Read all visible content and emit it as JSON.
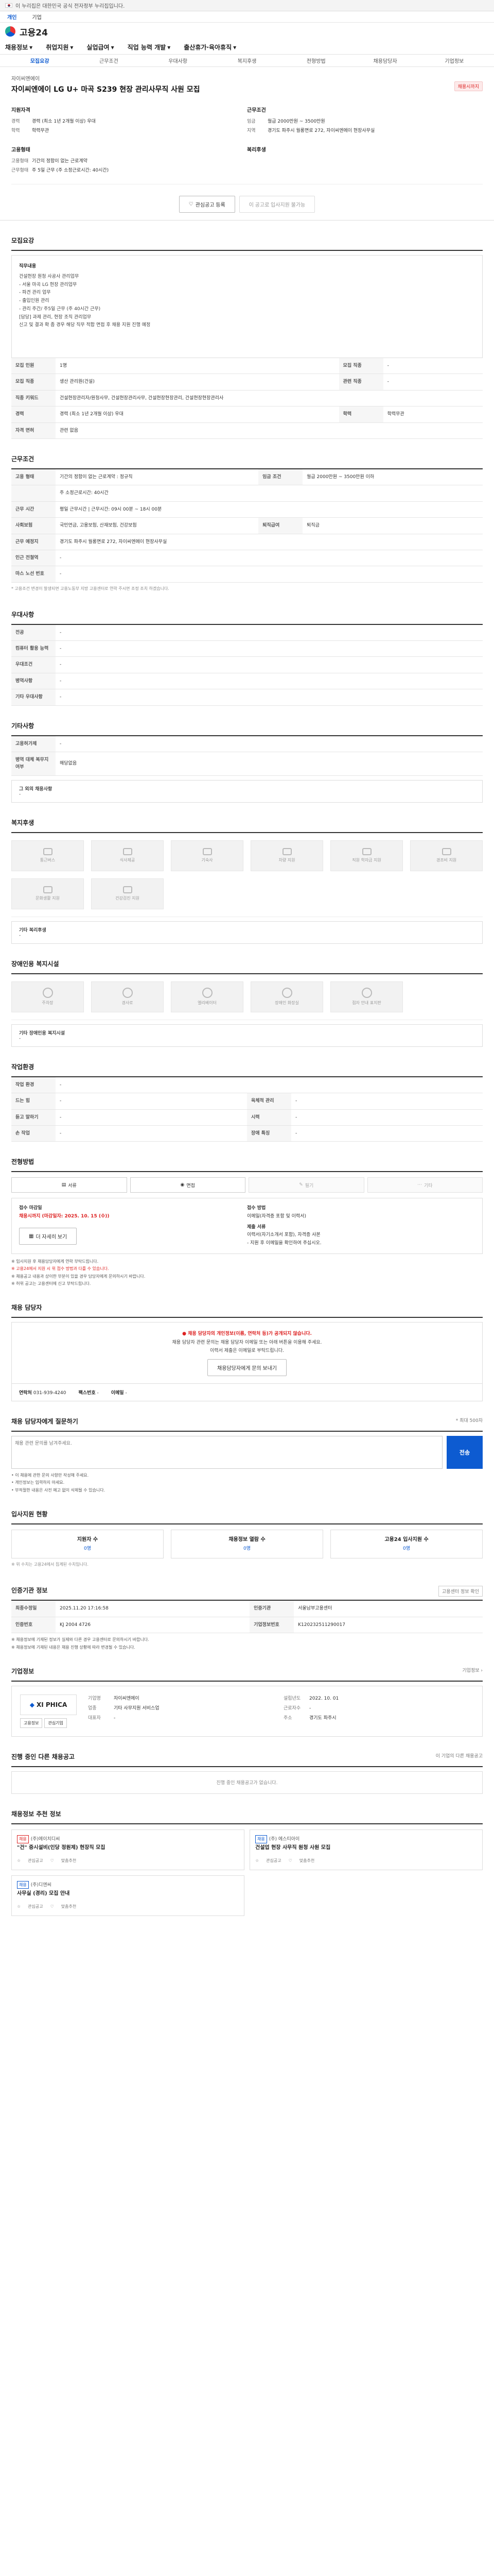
{
  "gov_bar": {
    "text": "이 누리집은 대한민국 공식 전자정부 누리집입니다."
  },
  "sub_bar": {
    "items": [
      "개인",
      "기업"
    ]
  },
  "logo": {
    "text": "고용24"
  },
  "gnb": {
    "items": [
      "채용정보",
      "취업지원",
      "실업급여",
      "직업 능력 개발",
      "출산휴가·육아휴직"
    ]
  },
  "tabs": {
    "items": [
      "모집요강",
      "근무조건",
      "우대사항",
      "복지후생",
      "전형방법",
      "채용담당자",
      "기업정보"
    ]
  },
  "summary": {
    "company": "자이씨엔에이",
    "title": "자이씨엔에이 LG U+ 마곡 S239 현장 관리사무직 사원 모집",
    "badge": "채용시까지",
    "qual_head": "지원자격",
    "qual": [
      {
        "k": "경력",
        "v": "경력 (최소 1년 2개월 이상) 우대"
      },
      {
        "k": "학력",
        "v": "학력무관"
      }
    ],
    "cond_head": "근무조건",
    "cond": [
      {
        "k": "임금",
        "v": "월급 2000만원 ~ 3500만원"
      },
      {
        "k": "지역",
        "v": "경기도 파주시 월롱면로 272, 자이씨엔에이 현장사무실"
      }
    ],
    "emp_head": "고용형태",
    "emp": [
      {
        "k": "고용형태",
        "v": "기간의 정함이 없는 근로계약"
      },
      {
        "k": "근무형태",
        "v": "주 5일 근무 (주 소정근로시간: 40시간)"
      }
    ],
    "benefit_head": "복리후생",
    "btn_save": "관심공고 등록",
    "btn_apply": "이 공고로 입사지원 불가능"
  },
  "recruit": {
    "title": "모집요강",
    "head": "직무내용",
    "lines": [
      "건설현장 원청 사공사 관리업무",
      "- 서울 마곡 LG 현장 관리업무",
      "- 파견 관리 업무",
      "- 출입인원 관리",
      "- 관리 주간/ 주5일 근무 (주 40시간 근무)",
      "[담당] 과제 관리, 현장 조직 관리업무",
      "신고 및 결과 확 좀 경우 해당 직무 적합 면접 후 채용 지원 진행 예정"
    ]
  },
  "recruit_table": [
    {
      "k": "모집 인원",
      "v": "1명",
      "k2": "모집 직종",
      "v2": "-"
    },
    {
      "k": "모집 직종",
      "v": "생산 관리원(건설)",
      "k2": "관련 직종",
      "v2": "-"
    },
    {
      "k": "직종 키워드",
      "v": "건설현장관리자/원청사무, 건설현장관리사무, 건설현장현장관리, 건설현장현장관리사",
      "k2": "",
      "v2": ""
    },
    {
      "k": "경력",
      "v": "경력 (최소 1년 2개월 이상) 우대",
      "k2": "학력",
      "v2": "학력무관"
    },
    {
      "k": "자격 면허",
      "v": "관련 없음",
      "k2": "",
      "v2": ""
    }
  ],
  "work": {
    "title": "근무조건",
    "rows": [
      {
        "k": "고용 형태",
        "v": "기간의 정함이 없는 근로계약 : 정규직",
        "k2": "임금 조건",
        "v2": "월급 2000만원 ~ 3500만원 이하"
      },
      {
        "k": "",
        "v": "주 소정근로시간: 40시간",
        "k2": "",
        "v2": ""
      },
      {
        "k": "근무 시간",
        "v": "평일 근무시간 | 근무시간: 09시 00분 ~ 18시 00분",
        "k2": "",
        "v2": ""
      },
      {
        "k": "사회보험",
        "v": "국민연금, 고용보험, 산재보험, 건강보험",
        "k2": "퇴직급여",
        "v2": "퇴직금"
      },
      {
        "k": "근무 예정지",
        "v": "경기도 파주시 월롱면로 272, 자이씨엔에이 현장사무실",
        "k2": "",
        "v2": ""
      },
      {
        "k": "인근 전철역",
        "v": "-",
        "k2": "",
        "v2": ""
      },
      {
        "k": "마스 노선 번호",
        "v": "-",
        "k2": "",
        "v2": ""
      }
    ],
    "note": "* 고용조건 변경이 발생되면 고용노동부 지방 고용센터로 연락 주시면 조정 조치 하겠습니다."
  },
  "prefer": {
    "title": "우대사항",
    "rows": [
      {
        "k": "전공",
        "v": "-"
      },
      {
        "k": "컴퓨터 활용 능력",
        "v": "-"
      },
      {
        "k": "우대조건",
        "v": "-"
      },
      {
        "k": "병역사항",
        "v": "-"
      },
      {
        "k": "기타 우대사항",
        "v": "-"
      }
    ]
  },
  "other": {
    "title": "기타사항",
    "rows": [
      {
        "k": "고용허가제",
        "v": "-"
      },
      {
        "k": "병역 대체 복무지 여부",
        "v": "해당없음"
      }
    ],
    "extra_head": "그 외의 채용사항",
    "extra_val": "-"
  },
  "welfare": {
    "title": "복지후생",
    "items": [
      "통근버스",
      "식사제공",
      "기숙사",
      "차량 지원",
      "직원 학자금 지원",
      "경조비 지원",
      "문화생활 지원",
      "건강검진 지원",
      "",
      "",
      "",
      ""
    ],
    "other_head": "기타 복리후생",
    "other_val": "-"
  },
  "disabled": {
    "title": "장애인용 복지시설",
    "items": [
      "주차장",
      "경사로",
      "엘리베이터",
      "장애인 화장실",
      "점자 안내 표지판"
    ],
    "other_head": "기타 장애인용 복지시설",
    "other_val": "-"
  },
  "work_env": {
    "title": "작업환경",
    "rows": [
      {
        "k": "작업 환경",
        "v": "-",
        "k2": "",
        "v2": ""
      },
      {
        "k": "드는 힘",
        "v": "-",
        "k2": "육체적 관리",
        "v2": "-"
      },
      {
        "k": "듣고 말하기",
        "v": "-",
        "k2": "시력",
        "v2": "-"
      },
      {
        "k": "손 작업",
        "v": "-",
        "k2": "장애 특징",
        "v2": "-"
      }
    ]
  },
  "method": {
    "title": "전형방법",
    "buttons": [
      "서류",
      "면접",
      "필기",
      "기타"
    ],
    "deadline_head": "접수 마감일",
    "deadline": "채용시까지 (마감일자: 2025. 10. 15 (수))",
    "detail_btn": "더 자세히 보기",
    "apply_head": "접수 방법",
    "apply_val": "이메일(자격증 포함 및 이력서)",
    "doc_head": "제출 서류",
    "doc_val": "이력서(자기소개서 포함), 자격증 사본",
    "contact_line": "- 지원 후 이메일을 확인하여 주십시오.",
    "notes": [
      "※ 입사지원 후 채용담당자에게 연락 부탁드립니다.",
      "※ 고용24에서 지원 시 위 접수 방법과 다를 수 있습니다.",
      "※ 채용공고 내용과 상이한 부분이 있을 경우 담당자에게 문의하시기 바랍니다.",
      "※ 허위 공고는 고용센터에 신고 부탁드립니다."
    ]
  },
  "manager": {
    "title": "채용 담당자",
    "alert_line1": "채용 담당자의 개인정보(이름, 연락처 등)가 공개되지 않습니다.",
    "alert_line2": "채용 담당자 관련 문의는 채용 담당자 이메일 또는 아래 버튼을 이용해 주세요.",
    "alert_line3": "이력서 제출은 이메일로 부탁드립니다.",
    "alert_btn": "채용담당자에게 문의 보내기",
    "email_k": "연락처",
    "email_v": "031-939-4240",
    "fax_k": "팩스번호",
    "fax_v": "-",
    "mail_k": "이메일",
    "mail_v": "-"
  },
  "qa": {
    "title": "채용 담당자에게 질문하기",
    "right": "* 최대 500자",
    "placeholder": "채용 관련 문의를 남겨주세요.",
    "submit": "전송",
    "notes": [
      "• 이 채용에 관한 문의 사항만 작성해 주세요.",
      "• 개인정보는 입력하지 마세요.",
      "• 부적절한 내용은 사전 예고 없이 삭제될 수 있습니다."
    ]
  },
  "status": {
    "title": "입사지원 현황",
    "items": [
      {
        "label": "지원자 수",
        "val": "0명"
      },
      {
        "label": "채용정보 열람 수",
        "val": "0명"
      },
      {
        "label": "고용24 입사지원 수",
        "val": "0명"
      }
    ],
    "note": "※ 위 수치는 고용24에서 집계된 수치입니다."
  },
  "mgmt": {
    "title": "인증기관 정보",
    "right_btn": "고용센터 정보 확인",
    "rows": [
      {
        "k": "최종수정일",
        "v": "2025.11.20 17:16:58",
        "k2": "인증기관",
        "v2": "서울남부고용센터"
      },
      {
        "k": "인증번호",
        "v": "KJ 2004 4726",
        "k2": "기업정보번호",
        "v2": "K120232511290017"
      }
    ],
    "notes": [
      "※ 채용정보에 기재된 정보가 실제와 다른 경우 고용센터로 문의하시기 바랍니다.",
      "※ 채용정보에 기재된 내용은 채용 진행 상황에 따라 변경될 수 있습니다."
    ]
  },
  "corp": {
    "title": "기업정보",
    "right": "기업정보 ›",
    "logo_text": "XI PHICA",
    "rows": [
      {
        "k": "기업명",
        "v": "자이씨엔에이"
      },
      {
        "k": "설립년도",
        "v": "2022. 10. 01"
      },
      {
        "k": "업종",
        "v": "기타 사무지원 서비스업"
      },
      {
        "k": "근로자수",
        "v": "-"
      },
      {
        "k": "대표자",
        "v": "-"
      },
      {
        "k": "주소",
        "v": "경기도 파주시"
      }
    ],
    "btn1": "고용정보",
    "btn2": "관심기업"
  },
  "others": {
    "title": "진행 중인 다른 채용공고",
    "right": "이 기업의 다른 채용공고",
    "empty": "진행 중인 채용공고가 없습니다."
  },
  "rec": {
    "title": "채용정보 추천 정보",
    "cards": [
      {
        "tag": "채용",
        "comp": "(주)에이치디씨",
        "title": "\"건\" 증시설비(인당 정원제) 현장직 모집",
        "a": "관심공고",
        "b": "맞춤추천"
      },
      {
        "tag": "채용",
        "comp": "(주) 에스티아이",
        "title": "건설업 현장 사무직 원청 사원 모집",
        "a": "관심공고",
        "b": "맞춤추천"
      },
      {
        "tag": "채용",
        "comp": "(주)디엔씨",
        "title": "사무실 (경리) 모집 안내",
        "a": "관심공고",
        "b": "맞춤추천"
      }
    ]
  }
}
